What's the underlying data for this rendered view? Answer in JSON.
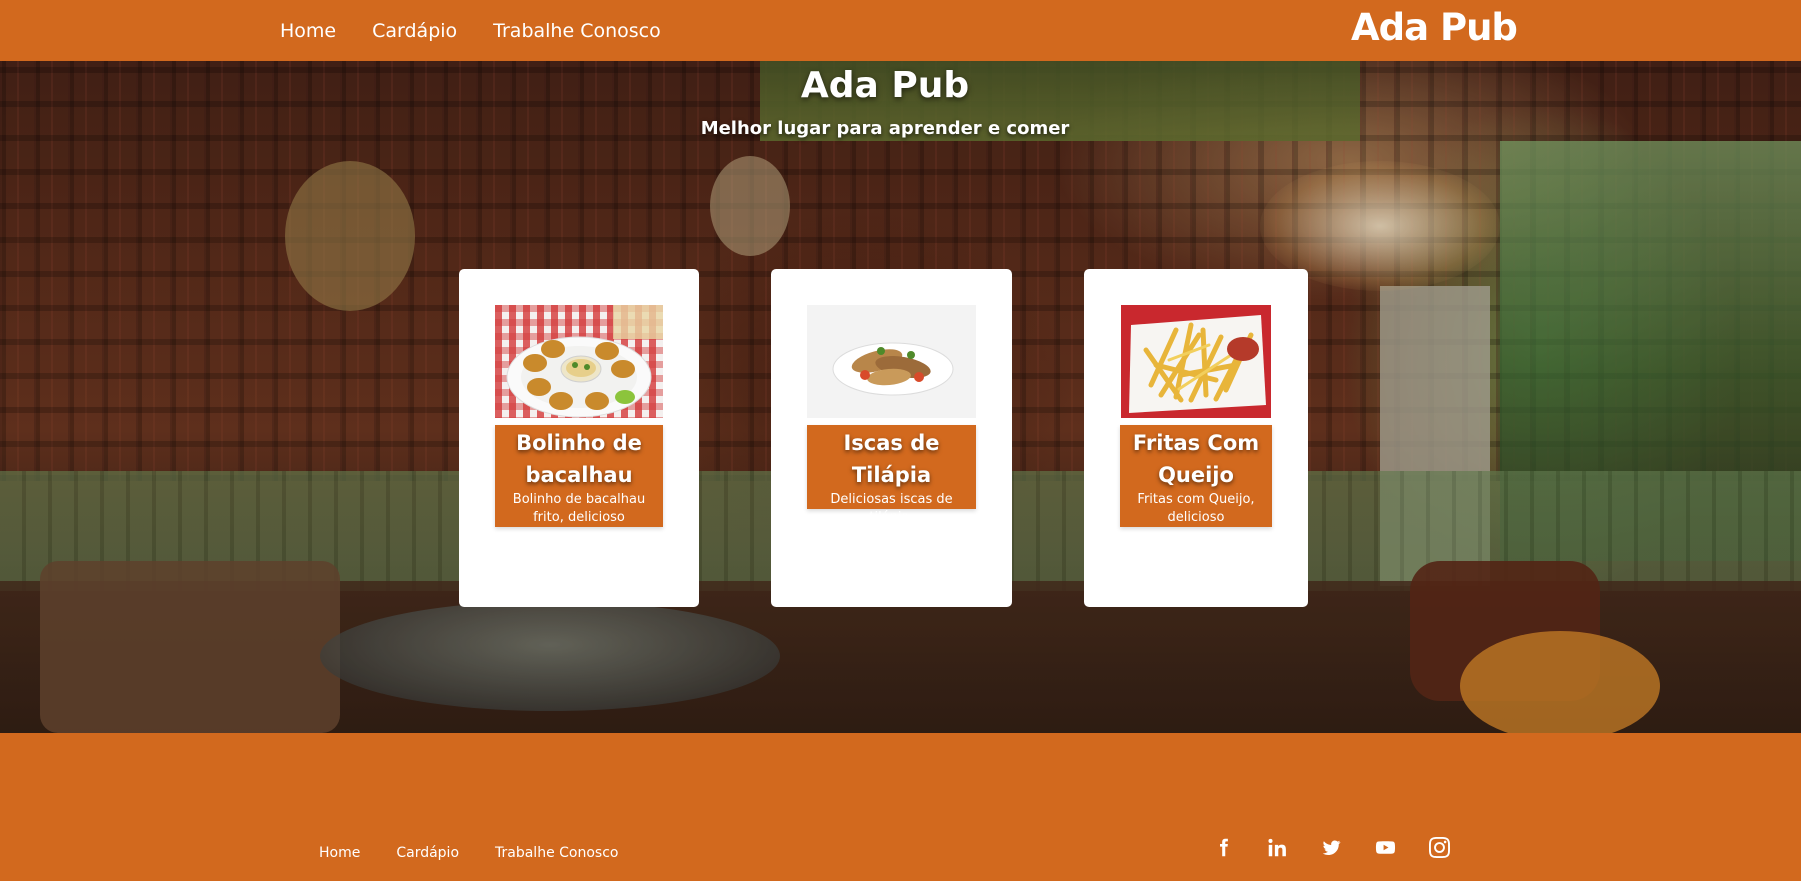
{
  "nav": {
    "links": [
      "Home",
      "Cardápio",
      "Trabalhe Conosco"
    ],
    "brand": "Ada Pub"
  },
  "hero": {
    "title": "Ada Pub",
    "subtitle": "Melhor lugar para aprender e comer"
  },
  "cards": [
    {
      "title": "Bolinho de bacalhau",
      "description": "Bolinho de bacalhau frito, delicioso",
      "image": "codfish-fritters-photo"
    },
    {
      "title": "Iscas de Tilápia",
      "description": "Deliciosas iscas de tilápia.",
      "image": "tilapia-strips-photo"
    },
    {
      "title": "Fritas Com Queijo",
      "description": "Fritas com Queijo, delicioso",
      "image": "cheese-fries-photo"
    }
  ],
  "footer": {
    "links": [
      "Home",
      "Cardápio",
      "Trabalhe Conosco"
    ],
    "social": [
      "facebook-icon",
      "linkedin-icon",
      "twitter-icon",
      "youtube-icon",
      "instagram-icon"
    ]
  },
  "colors": {
    "accent": "#d2691e",
    "card": "#ffffff",
    "text": "#ffffff"
  }
}
